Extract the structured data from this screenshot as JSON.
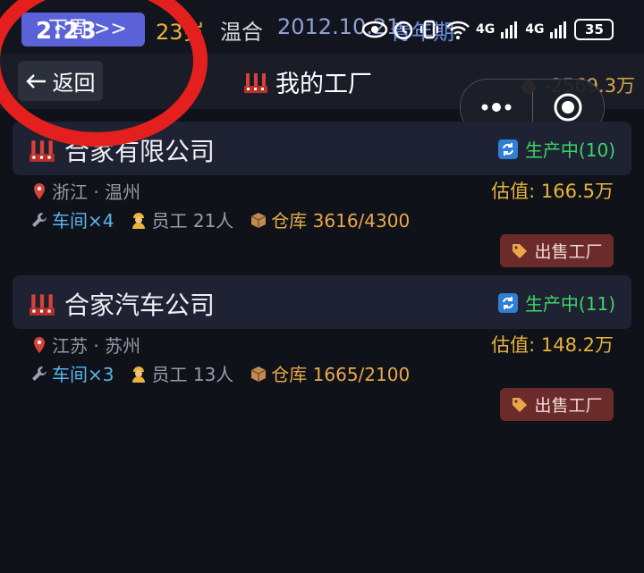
{
  "status_bar": {
    "week_label": "下周 >>",
    "time": "2:23",
    "age": "23岁",
    "temperature": "温合",
    "date": "2012.10.21",
    "life_stage": "青年期",
    "signal_label_1": "4G",
    "signal_label_2": "4G",
    "battery": "35"
  },
  "header": {
    "back_label": "返回",
    "title": "我的工厂",
    "money": "-2569.3万"
  },
  "factories": [
    {
      "name": "合家有限公司",
      "status": "生产中(10)",
      "location": "浙江 · 温州",
      "valuation": "估值: 166.5万",
      "workshops": "车间×4",
      "employees": "员工 21人",
      "warehouse": "仓库 3616/4300",
      "sell_label": "出售工厂"
    },
    {
      "name": "合家汽车公司",
      "status": "生产中(11)",
      "location": "江苏 · 苏州",
      "valuation": "估值: 148.2万",
      "workshops": "车间×3",
      "employees": "员工 13人",
      "warehouse": "仓库 1665/2100",
      "sell_label": "出售工厂"
    }
  ],
  "colors": {
    "background": "#10121a",
    "accent_gold": "#e8b43a",
    "status_green": "#3ed46a",
    "sell_button": "#6b2b2b",
    "annotation_red": "#e4201e"
  },
  "icons": [
    "factory-icon",
    "refresh-icon",
    "pin-icon",
    "wrench-icon",
    "worker-icon",
    "box-icon",
    "tag-icon",
    "money-bag-icon",
    "more-icon",
    "target-icon"
  ]
}
